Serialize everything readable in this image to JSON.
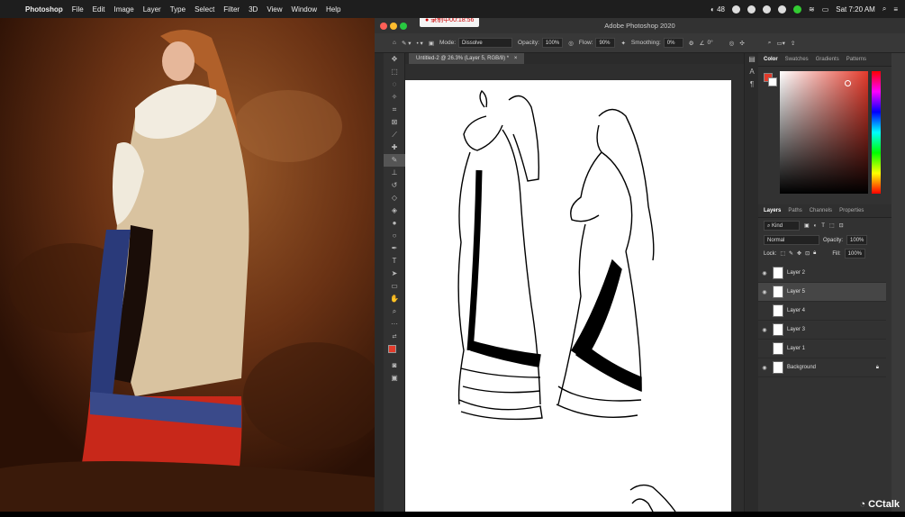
{
  "menubar": {
    "app": "Photoshop",
    "items": [
      "File",
      "Edit",
      "Image",
      "Layer",
      "Type",
      "Select",
      "Filter",
      "3D",
      "View",
      "Window",
      "Help"
    ],
    "status": {
      "battery_count": "48",
      "clock": "Sat 7:20 AM"
    }
  },
  "ps": {
    "window_title": "Adobe Photoshop 2020",
    "recording": "● 录制中00:18:56",
    "options": {
      "mode_label": "Mode:",
      "mode_value": "Dissolve",
      "opacity_label": "Opacity:",
      "opacity_value": "100%",
      "flow_label": "Flow:",
      "flow_value": "90%",
      "smoothing_label": "Smoothing:",
      "smoothing_value": "0%",
      "angle_value": "0°"
    },
    "doc_tab": "Untitled-2 @ 26.3% (Layer 5, RGB/8) *",
    "color_tabs": [
      "Color",
      "Swatches",
      "Gradients",
      "Patterns"
    ],
    "layer_tabs": [
      "Layers",
      "Paths",
      "Channels",
      "Properties"
    ],
    "kind_label": "Kind",
    "blend_mode": "Normal",
    "opacity_label": "Opacity:",
    "opacity_value": "100%",
    "lock_label": "Lock:",
    "fill_label": "Fill:",
    "fill_value": "100%",
    "layers": [
      {
        "name": "Layer 2",
        "visible": true,
        "selected": false
      },
      {
        "name": "Layer 5",
        "visible": true,
        "selected": true
      },
      {
        "name": "Layer 4",
        "visible": false,
        "selected": false
      },
      {
        "name": "Layer 3",
        "visible": true,
        "selected": false
      },
      {
        "name": "Layer 1",
        "visible": false,
        "selected": false
      },
      {
        "name": "Background",
        "visible": true,
        "selected": false
      }
    ],
    "foreground_color": "#e23b2b",
    "background_color": "#ffffff"
  },
  "watermark": "CCtalk"
}
